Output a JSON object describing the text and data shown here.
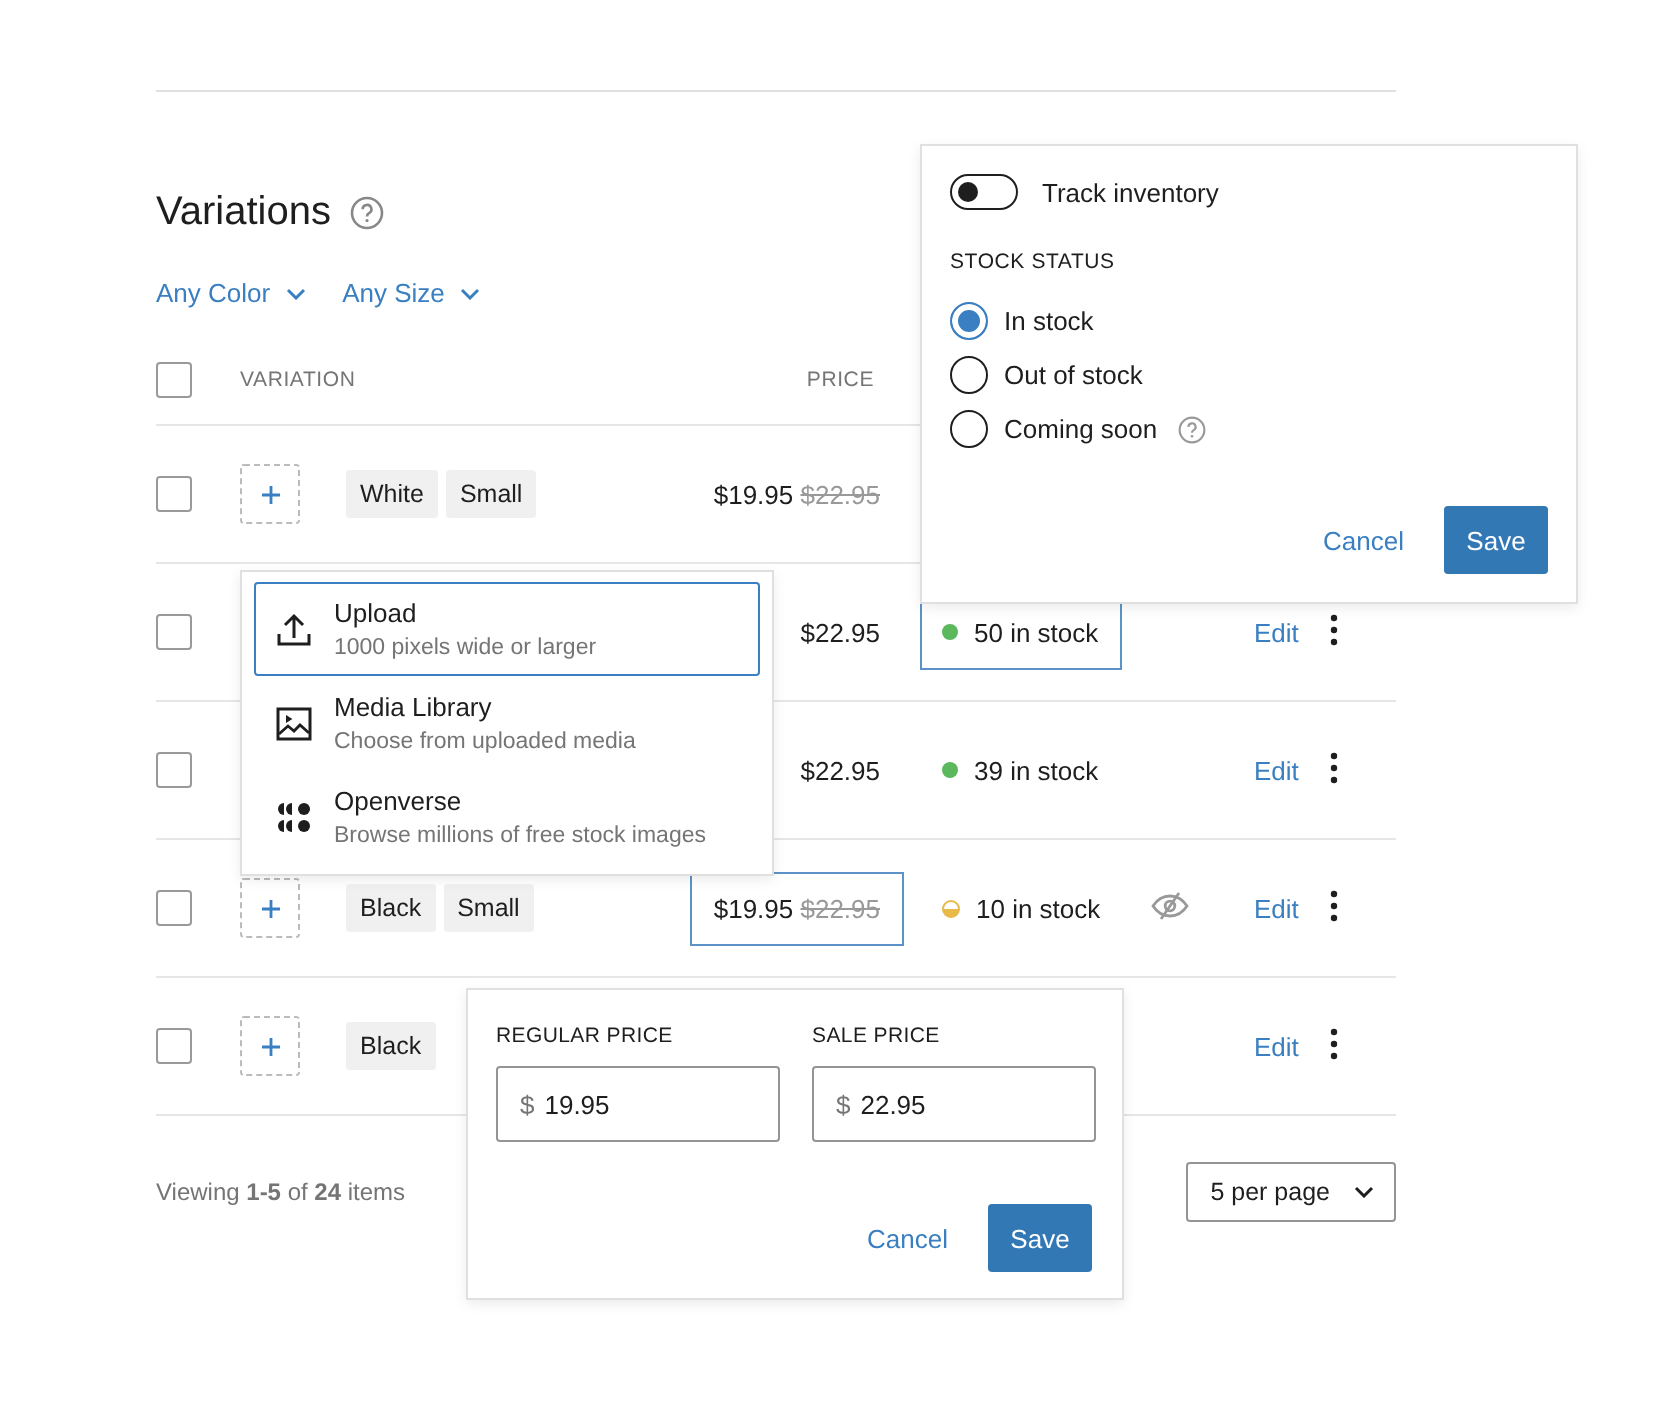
{
  "title": "Variations",
  "filters": [
    {
      "label": "Any Color"
    },
    {
      "label": "Any Size"
    }
  ],
  "select_all": {
    "checked": false
  },
  "columns": [
    {
      "label": "VARIATION"
    },
    {
      "label": "PRICE"
    }
  ],
  "rows": [
    {
      "checked": false,
      "add_image": true,
      "tags": [
        "White",
        "Small"
      ],
      "price": {
        "sale": "$19.95",
        "regular": "$22.95"
      },
      "price_focused": false
    },
    {
      "checked": false,
      "price": {
        "regular": "$22.95"
      },
      "price_focused": false,
      "stock": {
        "text": "50 in stock",
        "kind": "in_stock"
      },
      "stock_focused": true,
      "edit": "Edit"
    },
    {
      "checked": false,
      "price": {
        "regular": "$22.95"
      },
      "price_focused": false,
      "stock": {
        "text": "39 in stock",
        "kind": "in_stock"
      },
      "stock_focused": false,
      "edit": "Edit"
    },
    {
      "checked": false,
      "add_image": true,
      "tags": [
        "Black",
        "Small"
      ],
      "price": {
        "sale": "$19.95",
        "regular": "$22.95"
      },
      "price_focused": true,
      "stock": {
        "text": "10 in stock",
        "kind": "low_stock"
      },
      "stock_focused": false,
      "hidden": true,
      "edit": "Edit"
    },
    {
      "checked": false,
      "add_image": true,
      "tags": [
        "Black"
      ],
      "edit": "Edit"
    }
  ],
  "footer": {
    "viewing": "Viewing **1-5** of **24** items",
    "per_page": "5 per page"
  },
  "inventory_popover": {
    "track_label": "Track inventory",
    "track_on": false,
    "heading": "STOCK STATUS",
    "options": [
      {
        "label": "In stock",
        "selected": true
      },
      {
        "label": "Out of stock",
        "selected": false
      },
      {
        "label": "Coming soon",
        "selected": false,
        "help": true
      }
    ],
    "cancel": "Cancel",
    "save": "Save"
  },
  "media_menu": {
    "items": [
      {
        "kind": "upload",
        "title": "Upload",
        "subtitle": "1000 pixels wide or larger",
        "focused": true
      },
      {
        "kind": "library",
        "title": "Media Library",
        "subtitle": "Choose from uploaded media",
        "focused": false
      },
      {
        "kind": "openverse",
        "title": "Openverse",
        "subtitle": "Browse millions of free stock images",
        "focused": false
      }
    ]
  },
  "price_popover": {
    "fields": [
      {
        "label": "REGULAR PRICE",
        "currency": "$",
        "value": "19.95"
      },
      {
        "label": "SALE PRICE",
        "currency": "$",
        "value": "22.95"
      }
    ],
    "cancel": "Cancel",
    "save": "Save"
  }
}
